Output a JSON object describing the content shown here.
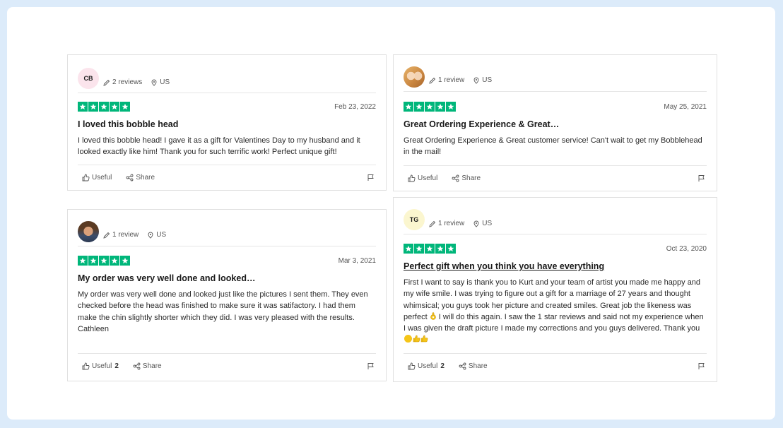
{
  "reviews": [
    {
      "avatar_initials": "CB",
      "review_count": "2 reviews",
      "country": "US",
      "date": "Feb 23, 2022",
      "rating": 5,
      "title": "I loved this bobble head",
      "body": "I loved this bobble head! I gave it as a gift for Valentines Day to my husband and it looked exactly like him! Thank you for such terrific work! Perfect unique gift!",
      "useful_label": "Useful",
      "useful_count": "",
      "share_label": "Share"
    },
    {
      "avatar_initials": "",
      "review_count": "1 review",
      "country": "US",
      "date": "May 25, 2021",
      "rating": 5,
      "title": "Great Ordering Experience & Great…",
      "body": "Great Ordering Experience & Great customer service! Can't wait to get my Bobblehead in the mail!",
      "useful_label": "Useful",
      "useful_count": "",
      "share_label": "Share"
    },
    {
      "avatar_initials": "",
      "review_count": "1 review",
      "country": "US",
      "date": "Mar 3, 2021",
      "rating": 5,
      "title": "My order was very well done and looked…",
      "body": "My order was very well done and looked just like the pictures I sent them. They even checked before the head was finished to make sure it was satifactory. I had them make the chin slightly shorter which they did. I was very pleased with the results.\nCathleen",
      "useful_label": "Useful",
      "useful_count": "2",
      "share_label": "Share"
    },
    {
      "avatar_initials": "TG",
      "review_count": "1 review",
      "country": "US",
      "date": "Oct 23, 2020",
      "rating": 5,
      "title": "Perfect gift when you think you have everything",
      "body_a": "First I want to say is thank you to Kurt and your team of artist you made me happy and my wife smile. I was trying to figure out a gift for a marriage of 27 years and thought whimsical; you guys took her picture and created smiles. Great job the likeness was perfect",
      "body_b": " I will do this again. I saw the 1 star reviews and said not my experience when I was given the draft picture I made my corrections and you guys delivered. Thank you",
      "useful_label": "Useful",
      "useful_count": "2",
      "share_label": "Share"
    }
  ],
  "colors": {
    "star": "#00b67a",
    "page_bg": "#dcebfa"
  },
  "icons": [
    "pencil-icon",
    "location-pin-icon",
    "star-icon",
    "thumbs-up-icon",
    "share-icon",
    "flag-icon",
    "ok-hand-emoji",
    "smile-emoji",
    "thumbs-up-emoji"
  ]
}
